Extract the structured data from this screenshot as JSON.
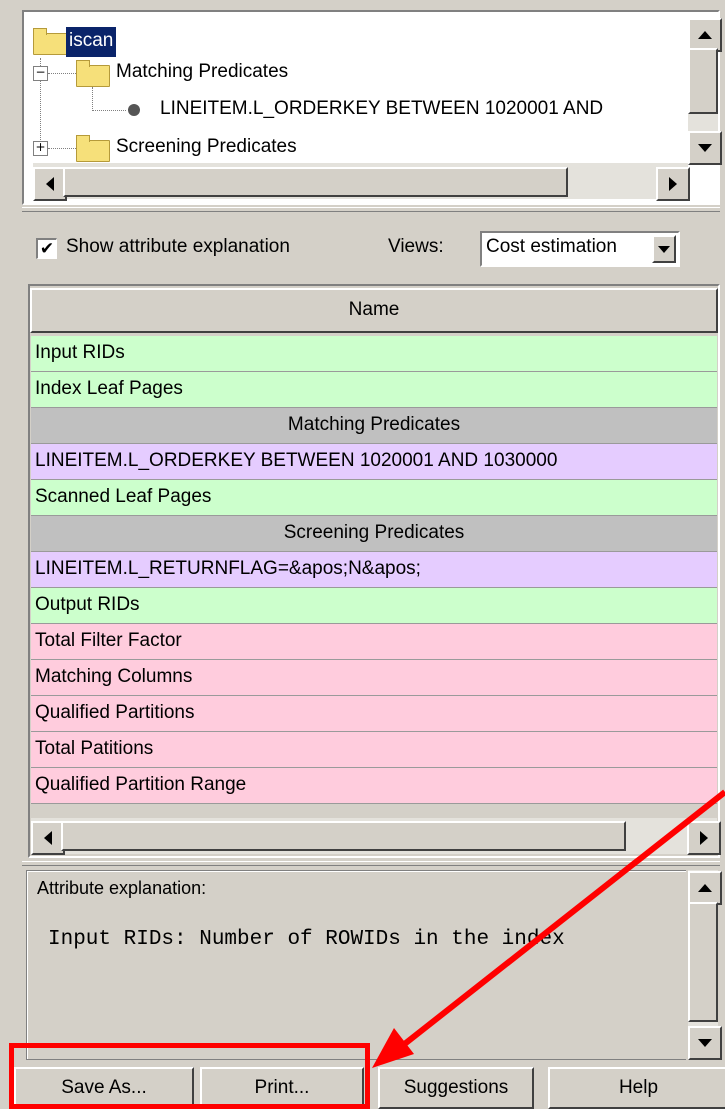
{
  "tree": {
    "root": "iscan",
    "matching_folder": "Matching Predicates",
    "matching_item": "LINEITEM.L_ORDERKEY BETWEEN 1020001 AND",
    "screening_folder": "Screening Predicates",
    "expander_minus": "−",
    "expander_plus": "+"
  },
  "options": {
    "show_explanation_label": "Show attribute explanation",
    "show_explanation_checked": true,
    "views_label": "Views:",
    "views_value": "Cost estimation"
  },
  "table": {
    "header": "Name",
    "rows": [
      {
        "label": "Input RIDs",
        "kind": "green"
      },
      {
        "label": "Index Leaf Pages",
        "kind": "green"
      },
      {
        "label": "Matching Predicates",
        "kind": "gray"
      },
      {
        "label": "LINEITEM.L_ORDERKEY BETWEEN 1020001 AND 1030000",
        "kind": "purple"
      },
      {
        "label": "Scanned Leaf Pages",
        "kind": "green"
      },
      {
        "label": "Screening Predicates",
        "kind": "gray"
      },
      {
        "label": "LINEITEM.L_RETURNFLAG=&apos;N&apos;",
        "kind": "purple"
      },
      {
        "label": "Output RIDs",
        "kind": "green"
      },
      {
        "label": "Total Filter Factor",
        "kind": "pink"
      },
      {
        "label": "Matching Columns",
        "kind": "pink"
      },
      {
        "label": "Qualified Partitions",
        "kind": "pink"
      },
      {
        "label": "Total Patitions",
        "kind": "pink"
      },
      {
        "label": "Qualified Partition Range",
        "kind": "pink"
      }
    ]
  },
  "explanation": {
    "legend": "Attribute explanation:",
    "text": "Input RIDs: Number of ROWIDs in the index"
  },
  "buttons": {
    "save_as": "Save As...",
    "print": "Print...",
    "suggestions": "Suggestions",
    "help": "Help"
  },
  "colors": {
    "green_row": "#ccffcc",
    "purple_row": "#e5ccff",
    "pink_row": "#ffccdd",
    "group_row": "#c0c0c0",
    "selection": "#0a246a",
    "annotation_red": "#ff0000"
  }
}
